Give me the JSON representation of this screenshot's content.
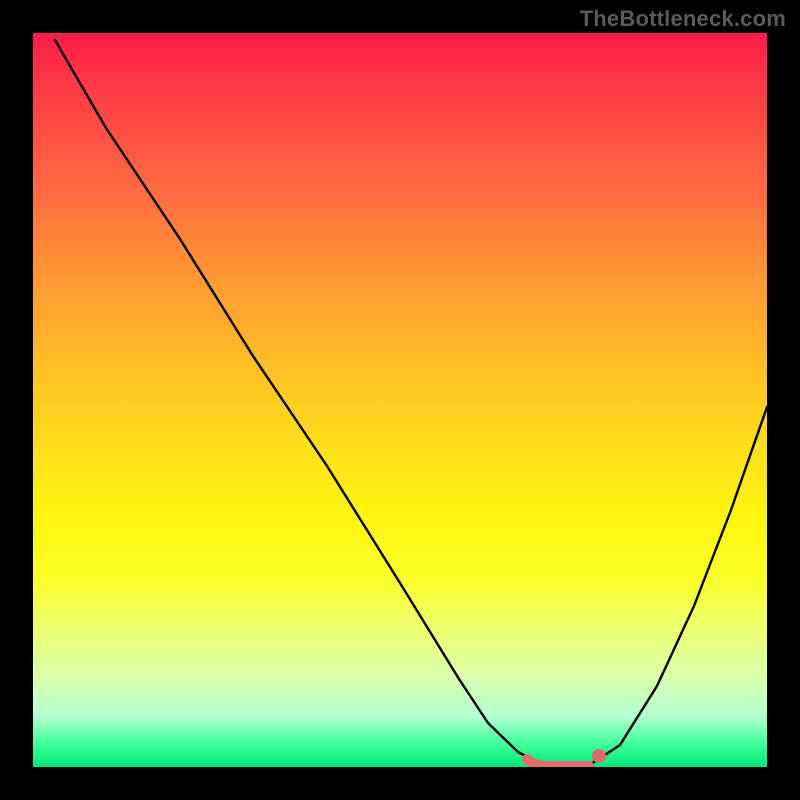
{
  "attribution": "TheBottleneck.com",
  "chart_data": {
    "type": "line",
    "title": "",
    "xlabel": "",
    "ylabel": "",
    "xlim": [
      0,
      100
    ],
    "ylim": [
      0,
      100
    ],
    "series": [
      {
        "name": "bottleneck-curve",
        "x": [
          3,
          10,
          20,
          30,
          40,
          50,
          58,
          62,
          66,
          70,
          73,
          76,
          80,
          85,
          90,
          95,
          100
        ],
        "y": [
          99,
          87,
          72,
          56,
          41,
          25,
          12,
          6,
          2,
          0,
          0,
          0,
          3,
          11,
          22,
          35,
          49
        ]
      }
    ],
    "flat_zone": {
      "x_start": 68,
      "x_end": 77,
      "y": 0
    },
    "marker": {
      "x": 77,
      "y": 1.5
    },
    "colors": {
      "curve": "#000000",
      "flat_segment": "#e26a6a",
      "marker": "#e26a6a",
      "background_top": "#ff1a4a",
      "background_bottom": "#00e878"
    }
  }
}
